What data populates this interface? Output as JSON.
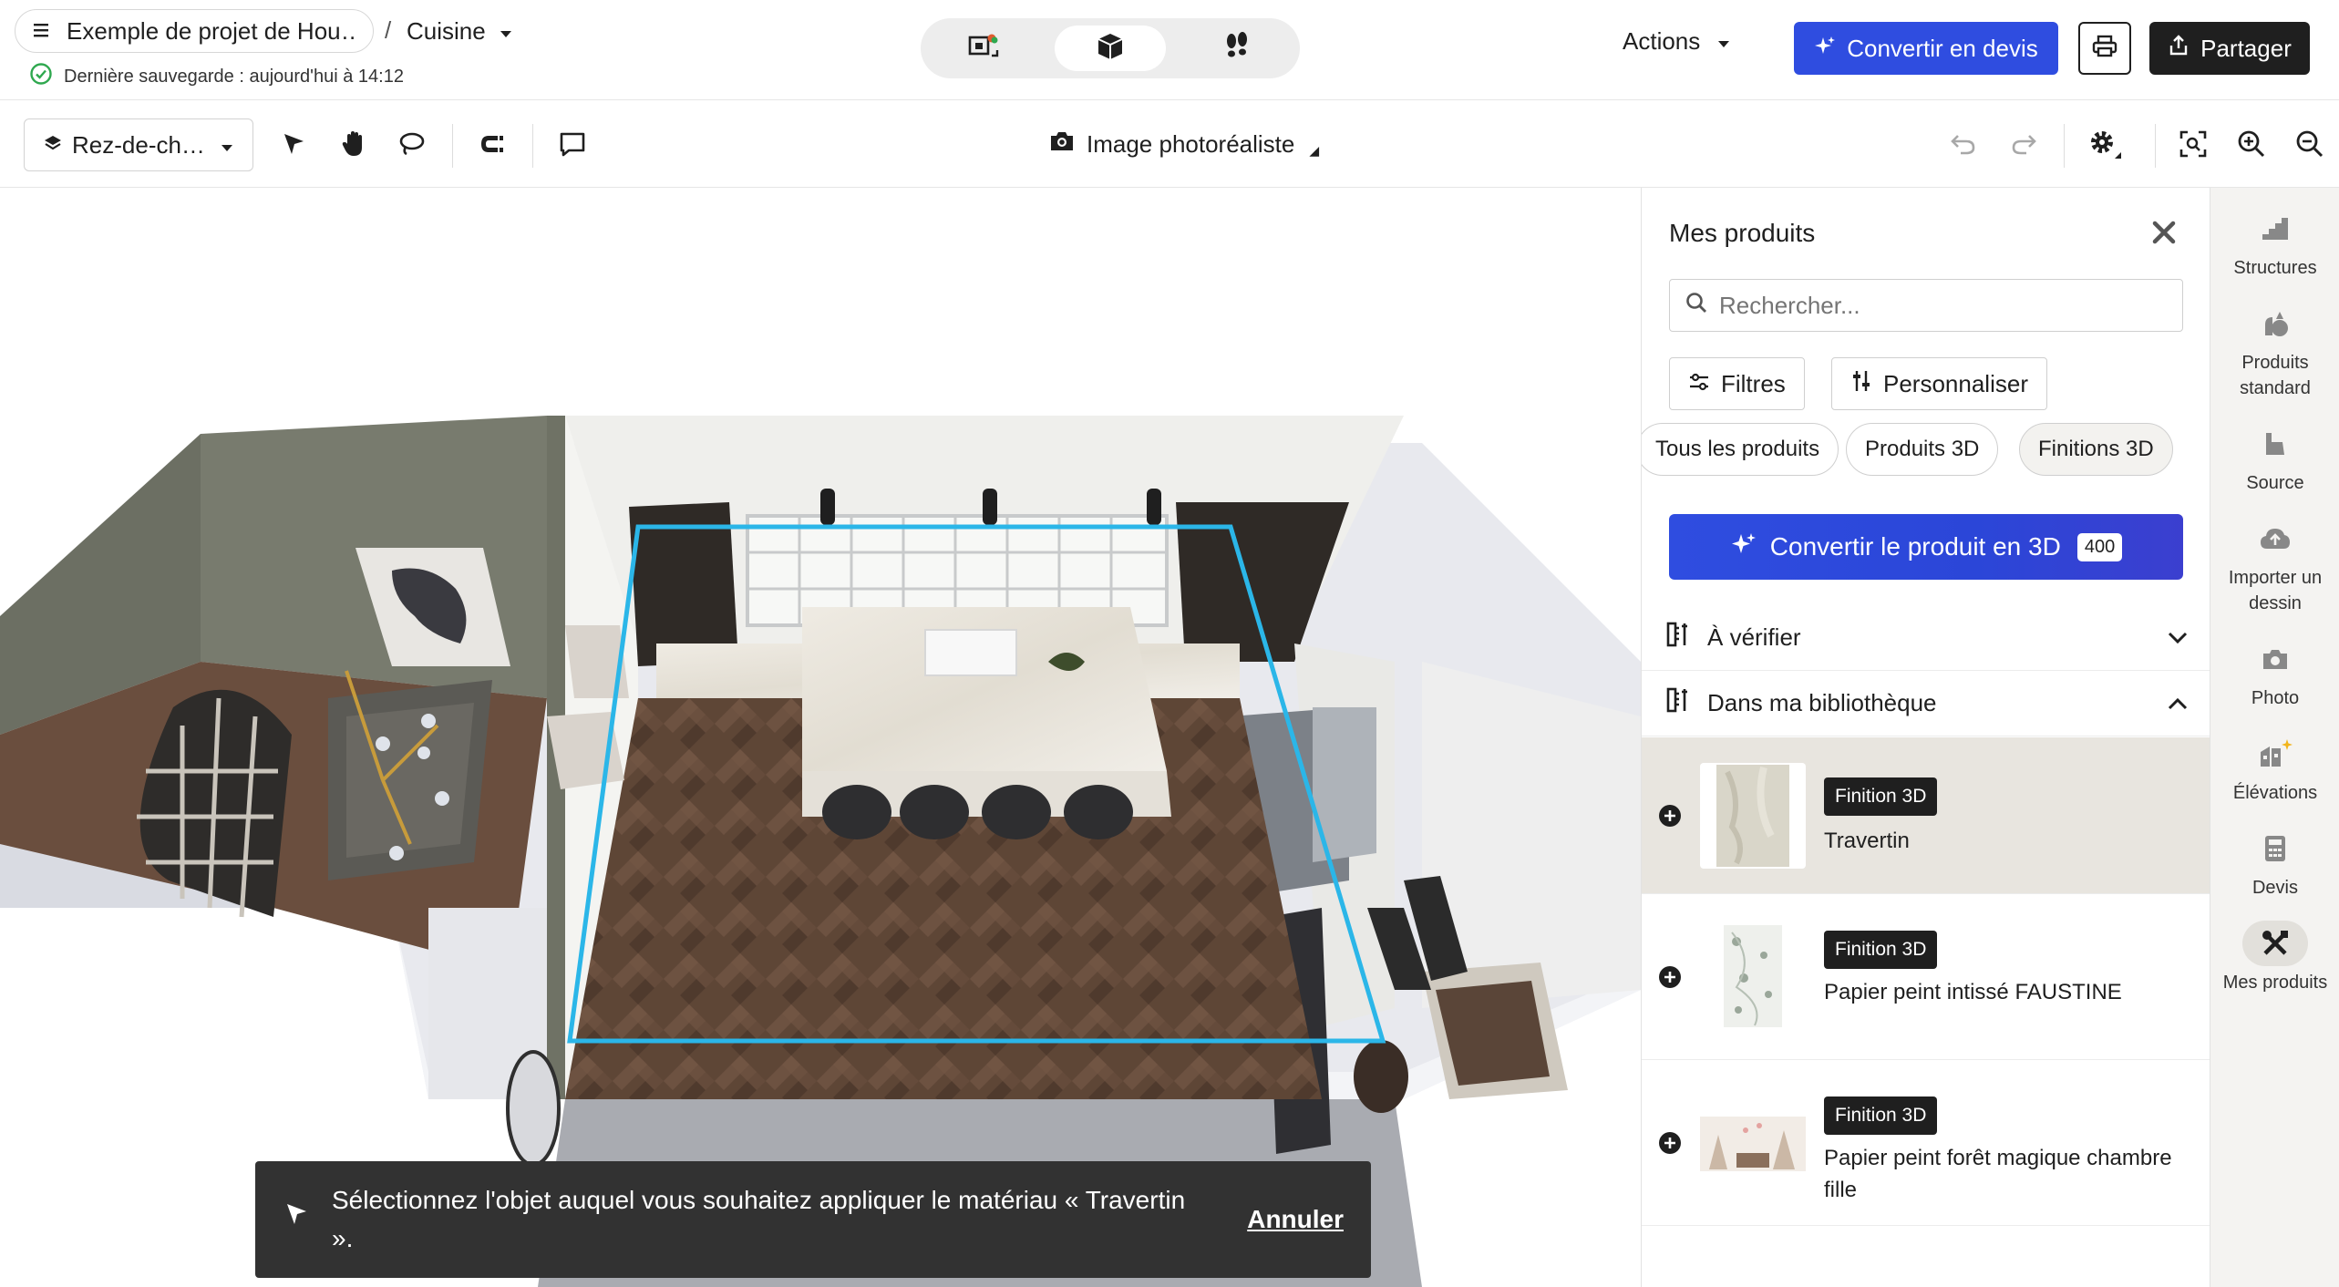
{
  "header": {
    "project_name": "Exemple de projet de Hou…",
    "breadcrumb_sep": "/",
    "room": "Cuisine",
    "save_status": "Dernière sauvegarde : aujourd'hui à 14:12",
    "actions_label": "Actions",
    "convert_label": "Convertir en devis",
    "share_label": "Partager"
  },
  "toolbar": {
    "level": "Rez-de-ch…",
    "render_mode": "Image photoréaliste"
  },
  "canvas": {
    "toast_message": "Sélectionnez l'objet auquel vous souhaitez appliquer le matériau « Travertin ».",
    "toast_cancel": "Annuler"
  },
  "panel": {
    "title": "Mes produits",
    "search_placeholder": "Rechercher...",
    "filters_label": "Filtres",
    "customize_label": "Personnaliser",
    "chips": [
      "Tous les produits",
      "Produits 3D",
      "Finitions 3D"
    ],
    "convert3d_label": "Convertir le produit en 3D",
    "convert3d_cost": "400",
    "sections": [
      {
        "title": "À vérifier",
        "expanded": false
      },
      {
        "title": "Dans ma bibliothèque",
        "expanded": true
      }
    ],
    "items": [
      {
        "badge": "Finition 3D",
        "name": "Travertin",
        "selected": true
      },
      {
        "badge": "Finition 3D",
        "name": "Papier peint intissé FAUSTINE",
        "selected": false
      },
      {
        "badge": "Finition 3D",
        "name": "Papier peint forêt magique chambre fille",
        "selected": false
      }
    ]
  },
  "rail": {
    "items": [
      {
        "label": "Structures",
        "icon": "stairs-icon"
      },
      {
        "label": "Produits standard",
        "icon": "products-icon"
      },
      {
        "label": "Source",
        "icon": "source-icon"
      },
      {
        "label": "Importer un dessin",
        "icon": "upload-icon"
      },
      {
        "label": "Photo",
        "icon": "camera-icon"
      },
      {
        "label": "Élévations",
        "icon": "elevation-icon"
      },
      {
        "label": "Devis",
        "icon": "calculator-icon"
      },
      {
        "label": "Mes produits",
        "icon": "tools-icon",
        "active": true
      }
    ]
  },
  "colors": {
    "primary": "#2f4de0",
    "dark": "#1f1f1f",
    "selection_outline": "#2bb6e8",
    "success": "#2fa84f"
  }
}
